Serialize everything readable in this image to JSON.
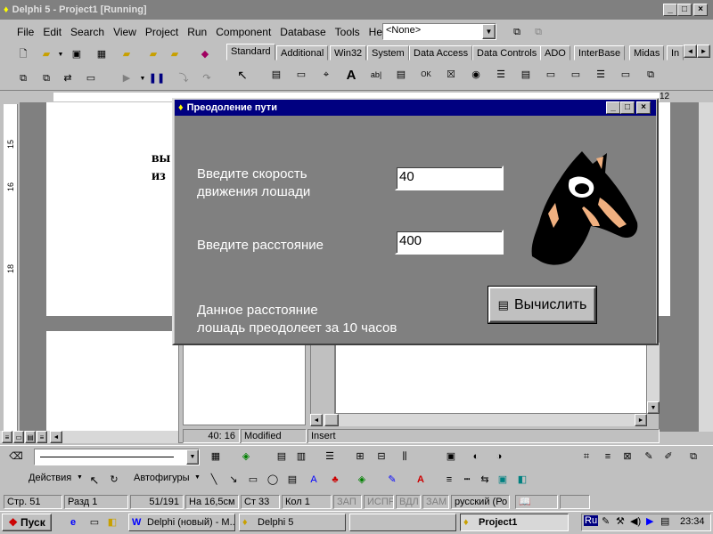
{
  "delphi": {
    "title": "Delphi 5 - Project1 [Running]",
    "menu": [
      "File",
      "Edit",
      "Search",
      "View",
      "Project",
      "Run",
      "Component",
      "Database",
      "Tools",
      "Help"
    ],
    "combo_value": "<None>",
    "tabs": [
      "Standard",
      "Additional",
      "Win32",
      "System",
      "Data Access",
      "Data Controls",
      "ADO",
      "InterBase",
      "Midas",
      "In"
    ]
  },
  "form": {
    "title": "Преодоление пути",
    "speed_label_1": "Введите скорость",
    "speed_label_2": "движения лошади",
    "speed_value": "40",
    "distance_label": "Введите расстояние",
    "distance_value": "400",
    "calc_button": "Вычислить",
    "result_1": "Данное расстояние",
    "result_2": "лошадь преодолеет за 10 часов"
  },
  "document": {
    "fragment_1": "вы",
    "fragment_2": "из",
    "ruler_left": [
      "15",
      "16",
      "18"
    ],
    "ruler_right_num": "12"
  },
  "editor_status": {
    "position": "40: 16",
    "state": "Modified",
    "mode": "Insert"
  },
  "word": {
    "actions_label": "Действия",
    "autoshapes_label": "Автофигуры",
    "status": [
      "Стр. 51",
      "Разд 1",
      "51/191",
      "На 16,5см",
      "Ст 33",
      "Кол 1",
      "ЗАП",
      "ИСПР",
      "ВДЛ",
      "ЗАМ",
      "русский (Ро"
    ]
  },
  "taskbar": {
    "start": "Пуск",
    "items": [
      "Delphi (новый) - M...",
      "Delphi 5",
      "Project1"
    ],
    "lang": "Ru",
    "time": "23:34"
  }
}
